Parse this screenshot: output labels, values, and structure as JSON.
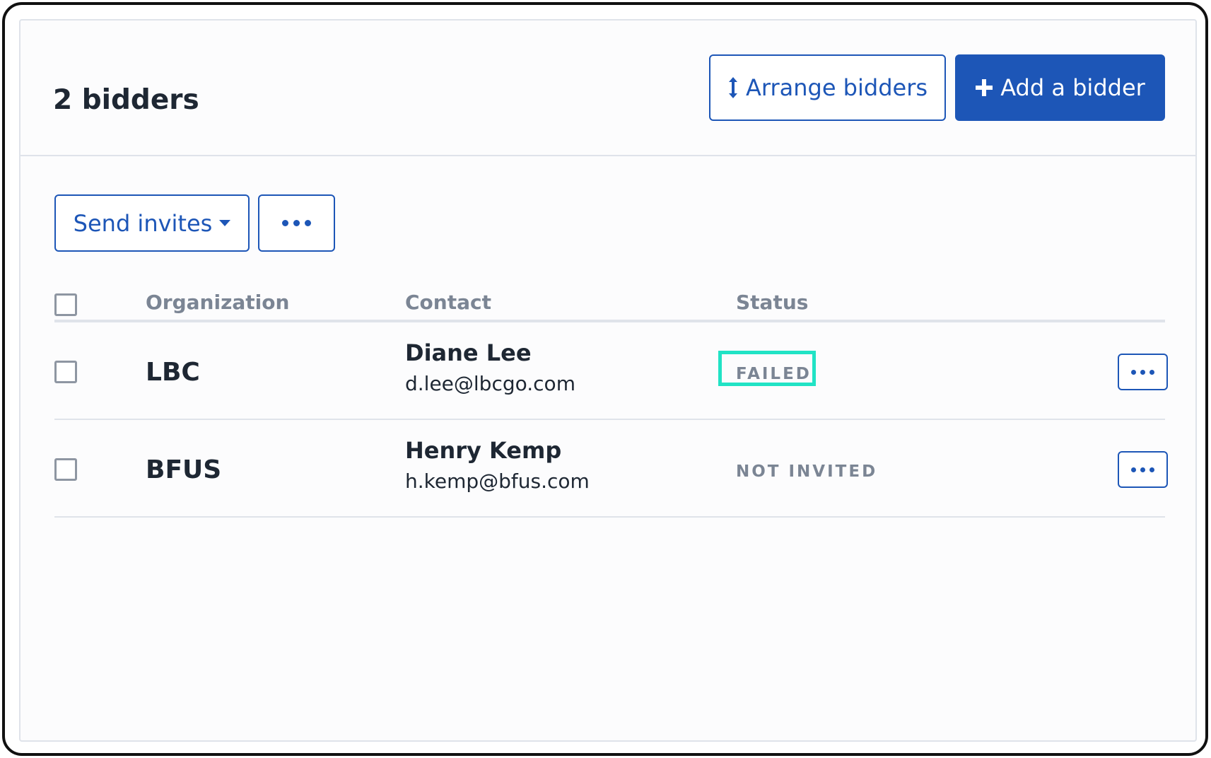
{
  "header": {
    "title": "2 bidders",
    "arrange_label": "Arrange bidders",
    "add_label": "Add a bidder"
  },
  "toolbar": {
    "send_invites_label": "Send invites"
  },
  "table": {
    "columns": [
      "Organization",
      "Contact",
      "Status"
    ],
    "rows": [
      {
        "organization": "LBC",
        "contact_name": "Diane Lee",
        "contact_email": "d.lee@lbcgo.com",
        "status": "FAILED"
      },
      {
        "organization": "BFUS",
        "contact_name": "Henry Kemp",
        "contact_email": "h.kemp@bfus.com",
        "status": "NOT INVITED"
      }
    ]
  },
  "icons": {
    "arrange": "vertical-arrows-icon",
    "add": "plus-icon",
    "dropdown": "caret-down-icon",
    "more": "more-dots-icon"
  },
  "colors": {
    "accent": "#1d56b7",
    "highlight": "#21e3c5",
    "text": "#1e2733",
    "muted": "#7b8594"
  }
}
